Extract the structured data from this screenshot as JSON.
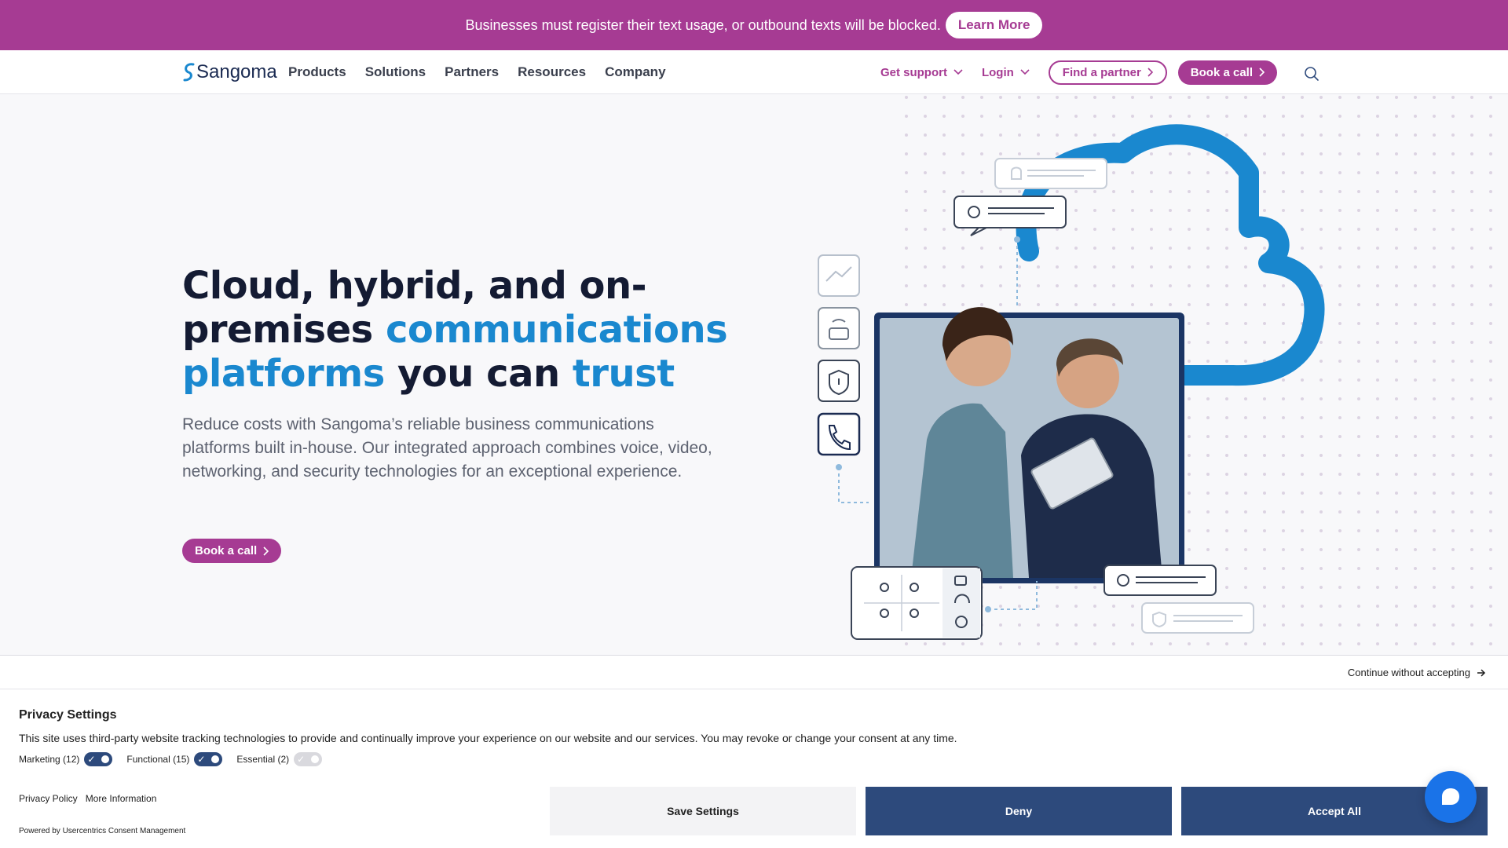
{
  "announcement": {
    "text": "Businesses must register their text usage, or outbound texts will be blocked.",
    "button": "Learn More"
  },
  "nav": {
    "logo": "Sangoma",
    "links": [
      "Products",
      "Solutions",
      "Partners",
      "Resources",
      "Company"
    ],
    "get_support": "Get support",
    "login": "Login",
    "find_partner": "Find a partner",
    "book_call": "Book a call"
  },
  "hero": {
    "title_part1": "Cloud, hybrid, and on-premises ",
    "title_accent1": "communications platforms",
    "title_part2": " you can ",
    "title_accent2": "trust",
    "subtitle": "Reduce costs with Sangoma’s reliable business communications platforms built in-house. Our integrated approach combines voice, video, networking, and security technologies for an exceptional experience.",
    "cta": "Book a call"
  },
  "consent": {
    "continue": "Continue without accepting",
    "title": "Privacy Settings",
    "description": "This site uses third-party website tracking technologies to provide and continually improve your experience on our website and our services. You may revoke or change your consent at any time.",
    "toggles": [
      {
        "label": "Marketing (12)",
        "on": true
      },
      {
        "label": "Functional (15)",
        "on": true
      },
      {
        "label": "Essential (2)",
        "on": true
      }
    ],
    "privacy_policy": "Privacy Policy",
    "more_info": "More Information",
    "powered_by": "Powered by Usercentrics Consent Management",
    "save": "Save Settings",
    "deny": "Deny",
    "accept": "Accept All"
  },
  "colors": {
    "brand_magenta": "#a63b93",
    "accent_blue": "#1a88cf",
    "consent_navy": "#2d4a7c"
  }
}
